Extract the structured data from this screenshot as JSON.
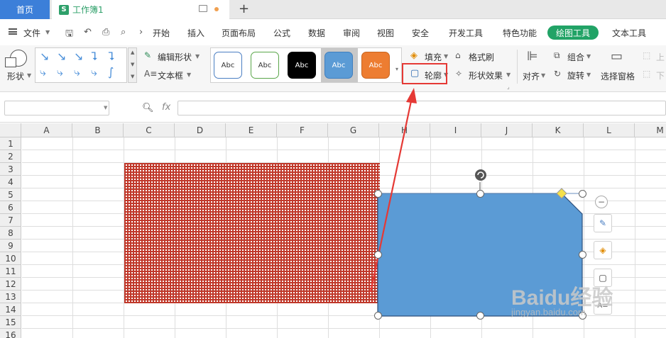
{
  "tabs": {
    "home": "首页",
    "workbook": "工作簿1",
    "workbook_logo": "S"
  },
  "menu": {
    "file": "文件",
    "items": [
      "开始",
      "插入",
      "页面布局",
      "公式",
      "数据",
      "审阅",
      "视图",
      "安全",
      "开发工具",
      "特色功能"
    ],
    "active": "绘图工具",
    "last": "文本工具"
  },
  "ribbon": {
    "shape": "形状",
    "edit_shape": "编辑形状",
    "text_box": "文本框",
    "style_labels": [
      "Abc",
      "Abc",
      "Abc",
      "Abc",
      "Abc"
    ],
    "fill": "填充",
    "outline": "轮廓",
    "format_brush": "格式刷",
    "shape_effect": "形状效果",
    "align": "对齐",
    "group": "组合",
    "rotate": "旋转",
    "selection_pane": "选择窗格",
    "up": "上",
    "down": "下"
  },
  "formula": {
    "fx": "fx",
    "name_box": "",
    "value": ""
  },
  "columns": [
    "A",
    "B",
    "C",
    "D",
    "E",
    "F",
    "G",
    "H",
    "I",
    "J",
    "K",
    "L",
    "M"
  ],
  "rows": [
    "1",
    "2",
    "3",
    "4",
    "5",
    "6",
    "7",
    "8",
    "9",
    "10",
    "11",
    "12",
    "13",
    "14",
    "15",
    "16"
  ],
  "watermark": {
    "brand": "Baidu经验",
    "url": "jingyan.baidu.com"
  },
  "colors": {
    "accent": "#21a366",
    "home": "#3c7fd9",
    "shape_fill": "#5b9bd5",
    "highlight": "#e53935",
    "dashed": "#c0392b"
  }
}
